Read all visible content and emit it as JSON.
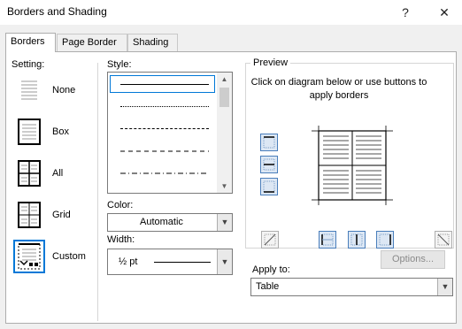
{
  "window": {
    "title": "Borders and Shading",
    "help_glyph": "?",
    "close_glyph": "✕"
  },
  "tabs": [
    {
      "label": "Borders",
      "active": true
    },
    {
      "label": "Page Border",
      "active": false
    },
    {
      "label": "Shading",
      "active": false
    }
  ],
  "setting": {
    "label": "Setting:",
    "items": [
      {
        "label": "None",
        "icon": "setting-none-icon",
        "selected": false
      },
      {
        "label": "Box",
        "icon": "setting-box-icon",
        "selected": false
      },
      {
        "label": "All",
        "icon": "setting-all-icon",
        "selected": false
      },
      {
        "label": "Grid",
        "icon": "setting-grid-icon",
        "selected": false
      },
      {
        "label": "Custom",
        "icon": "setting-custom-icon",
        "selected": true
      }
    ]
  },
  "style": {
    "label": "Style:",
    "options": [
      "solid",
      "dotted",
      "dashed-small",
      "dashed-large",
      "dash-dot",
      "dash-dot-dot"
    ],
    "selected": "solid"
  },
  "color": {
    "label": "Color:",
    "value": "Automatic"
  },
  "width": {
    "label": "Width:",
    "value": "½ pt"
  },
  "preview": {
    "label": "Preview",
    "instruction": "Click on diagram below or use buttons to apply borders",
    "border_buttons": [
      {
        "name": "top-border",
        "active": true
      },
      {
        "name": "inside-horizontal-border",
        "active": true
      },
      {
        "name": "bottom-border",
        "active": true
      },
      {
        "name": "diagonal-down-border",
        "active": false
      },
      {
        "name": "left-border",
        "active": true
      },
      {
        "name": "inside-vertical-border",
        "active": true
      },
      {
        "name": "right-border",
        "active": true
      },
      {
        "name": "diagonal-up-border",
        "active": false
      }
    ]
  },
  "apply_to": {
    "label": "Apply to:",
    "value": "Table"
  },
  "options_button": {
    "label": "Options...",
    "enabled": false
  },
  "colors": {
    "accent": "#0078d7",
    "preview_button_bg": "#dce7f4",
    "preview_button_border": "#4a7ebb"
  }
}
